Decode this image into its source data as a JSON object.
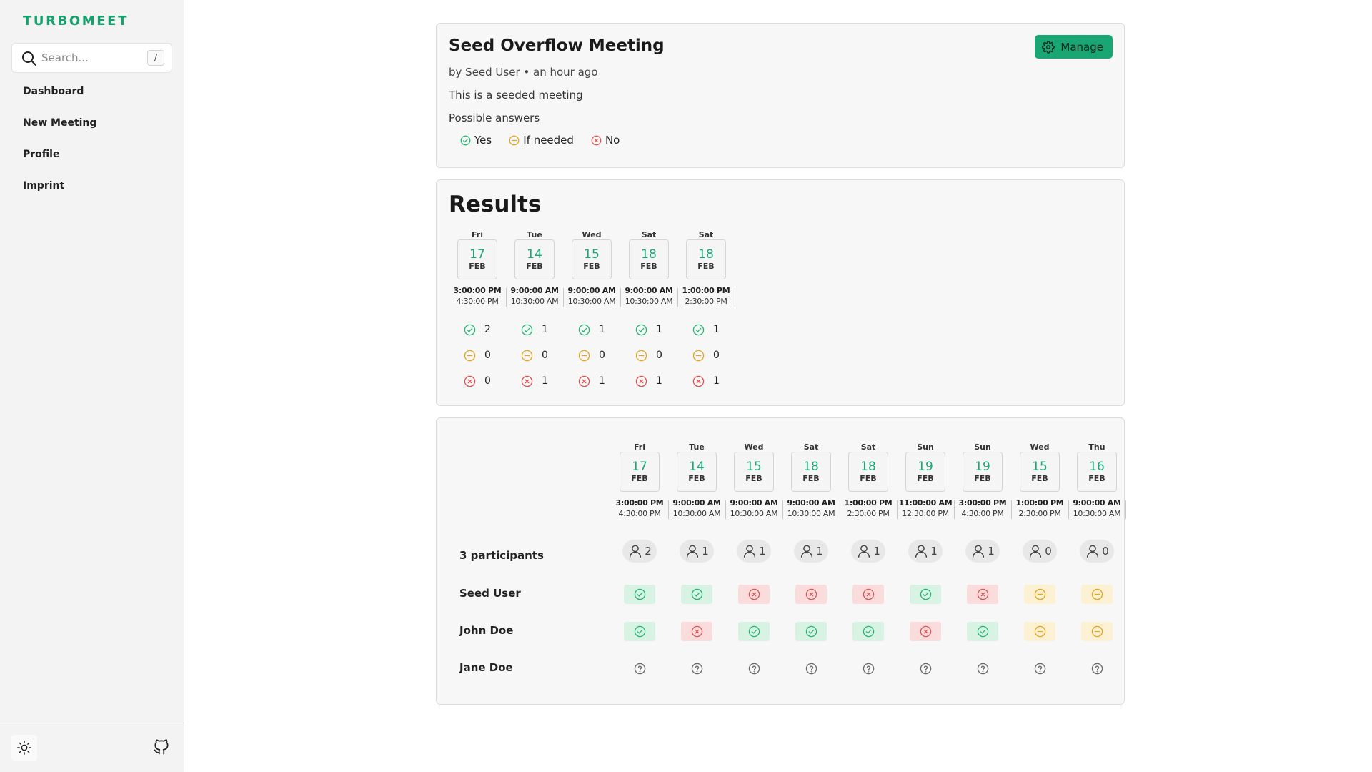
{
  "sidebar": {
    "brand": "TURBOMEET",
    "search_placeholder": "Search...",
    "search_shortcut": "/",
    "items": [
      {
        "label": "Dashboard"
      },
      {
        "label": "New Meeting"
      },
      {
        "label": "Profile"
      },
      {
        "label": "Imprint"
      }
    ]
  },
  "meeting": {
    "title": "Seed Overflow Meeting",
    "manage_label": "Manage",
    "meta": "by Seed User • an hour ago",
    "description": "This is a seeded meeting",
    "possible_label": "Possible answers",
    "answers": [
      {
        "label": "Yes",
        "icon": "yes-icon"
      },
      {
        "label": "If needed",
        "icon": "if-needed-icon"
      },
      {
        "label": "No",
        "icon": "no-icon"
      }
    ]
  },
  "results": {
    "title": "Results",
    "columns": [
      {
        "dow": "Fri",
        "day": "17",
        "month": "FEB",
        "start": "3:00:00 PM",
        "end": "4:30:00 PM",
        "yes": "2",
        "maybe": "0",
        "no": "0"
      },
      {
        "dow": "Tue",
        "day": "14",
        "month": "FEB",
        "start": "9:00:00 AM",
        "end": "10:30:00 AM",
        "yes": "1",
        "maybe": "0",
        "no": "1"
      },
      {
        "dow": "Wed",
        "day": "15",
        "month": "FEB",
        "start": "9:00:00 AM",
        "end": "10:30:00 AM",
        "yes": "1",
        "maybe": "0",
        "no": "1"
      },
      {
        "dow": "Sat",
        "day": "18",
        "month": "FEB",
        "start": "9:00:00 AM",
        "end": "10:30:00 AM",
        "yes": "1",
        "maybe": "0",
        "no": "1"
      },
      {
        "dow": "Sat",
        "day": "18",
        "month": "FEB",
        "start": "1:00:00 PM",
        "end": "2:30:00 PM",
        "yes": "1",
        "maybe": "0",
        "no": "1"
      }
    ]
  },
  "grid": {
    "participants_label": "3 participants",
    "columns": [
      {
        "dow": "Fri",
        "day": "17",
        "month": "FEB",
        "start": "3:00:00 PM",
        "end": "4:30:00 PM",
        "count": "2"
      },
      {
        "dow": "Tue",
        "day": "14",
        "month": "FEB",
        "start": "9:00:00 AM",
        "end": "10:30:00 AM",
        "count": "1"
      },
      {
        "dow": "Wed",
        "day": "15",
        "month": "FEB",
        "start": "9:00:00 AM",
        "end": "10:30:00 AM",
        "count": "1"
      },
      {
        "dow": "Sat",
        "day": "18",
        "month": "FEB",
        "start": "9:00:00 AM",
        "end": "10:30:00 AM",
        "count": "1"
      },
      {
        "dow": "Sat",
        "day": "18",
        "month": "FEB",
        "start": "1:00:00 PM",
        "end": "2:30:00 PM",
        "count": "1"
      },
      {
        "dow": "Sun",
        "day": "19",
        "month": "FEB",
        "start": "11:00:00 AM",
        "end": "12:30:00 PM",
        "count": "1"
      },
      {
        "dow": "Sun",
        "day": "19",
        "month": "FEB",
        "start": "3:00:00 PM",
        "end": "4:30:00 PM",
        "count": "1"
      },
      {
        "dow": "Wed",
        "day": "15",
        "month": "FEB",
        "start": "1:00:00 PM",
        "end": "2:30:00 PM",
        "count": "0"
      },
      {
        "dow": "Thu",
        "day": "16",
        "month": "FEB",
        "start": "9:00:00 AM",
        "end": "10:30:00 AM",
        "count": "0"
      }
    ],
    "participants": [
      {
        "name": "Seed User",
        "answers": [
          "yes",
          "yes",
          "no",
          "no",
          "no",
          "yes",
          "no",
          "maybe",
          "maybe"
        ]
      },
      {
        "name": "John Doe",
        "answers": [
          "yes",
          "no",
          "yes",
          "yes",
          "yes",
          "no",
          "yes",
          "maybe",
          "maybe"
        ]
      },
      {
        "name": "Jane Doe",
        "answers": [
          "unknown",
          "unknown",
          "unknown",
          "unknown",
          "unknown",
          "unknown",
          "unknown",
          "unknown",
          "unknown"
        ]
      }
    ]
  },
  "colors": {
    "accent": "#1aa673",
    "yes": "#22b573",
    "maybe": "#e8a317",
    "no": "#e05252",
    "unknown": "#666666"
  }
}
